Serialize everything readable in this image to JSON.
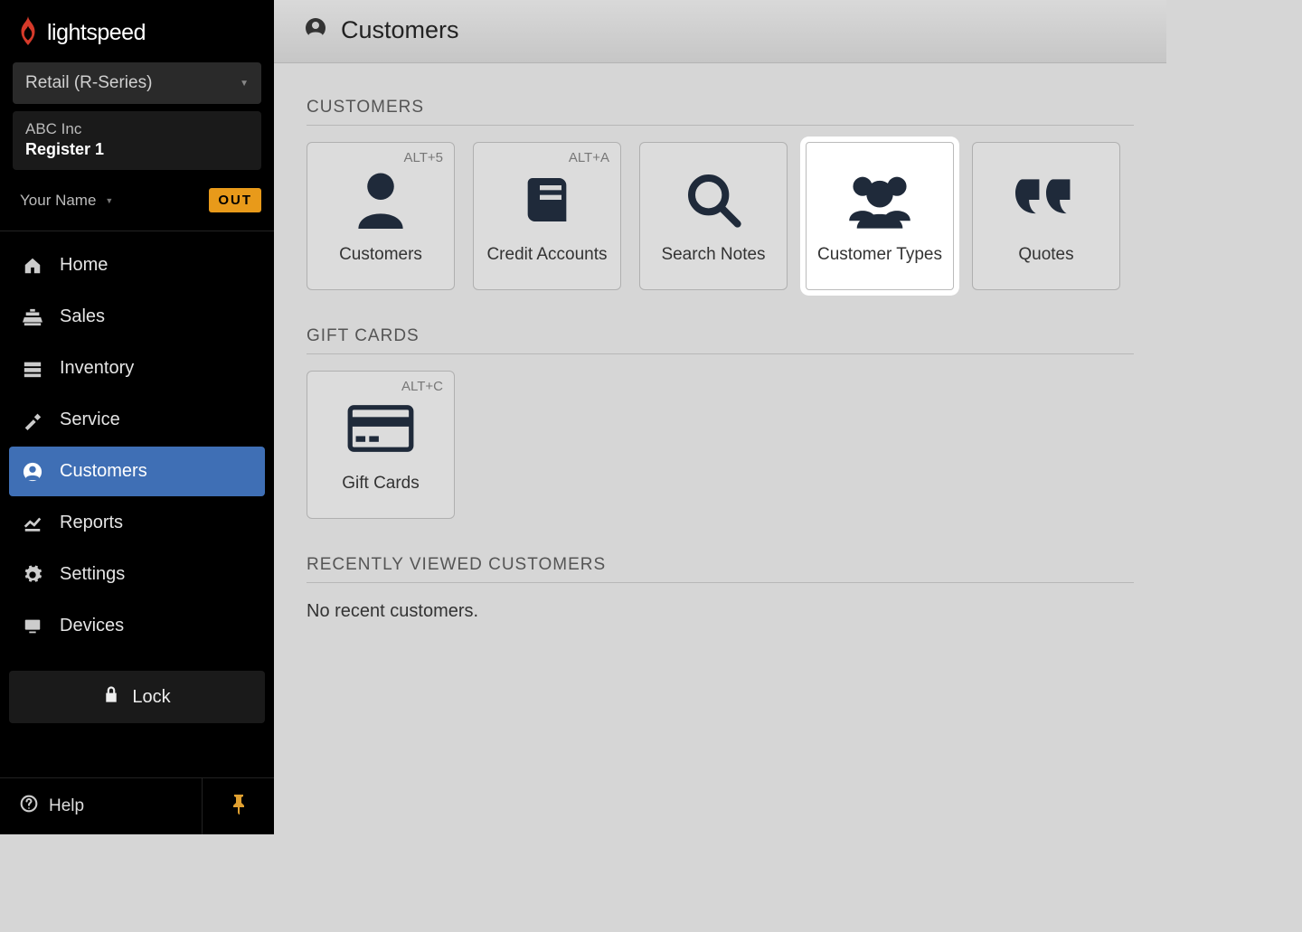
{
  "brand": "lightspeed",
  "product_selector": "Retail (R-Series)",
  "company": "ABC Inc",
  "register": "Register 1",
  "user_name": "Your Name",
  "out_label": "OUT",
  "nav": [
    {
      "label": "Home"
    },
    {
      "label": "Sales"
    },
    {
      "label": "Inventory"
    },
    {
      "label": "Service"
    },
    {
      "label": "Customers"
    },
    {
      "label": "Reports"
    },
    {
      "label": "Settings"
    },
    {
      "label": "Devices"
    }
  ],
  "lock_label": "Lock",
  "help_label": "Help",
  "page_title": "Customers",
  "sections": {
    "customers": {
      "heading": "CUSTOMERS",
      "tiles": [
        {
          "label": "Customers",
          "shortcut": "ALT+5"
        },
        {
          "label": "Credit Accounts",
          "shortcut": "ALT+A"
        },
        {
          "label": "Search Notes",
          "shortcut": ""
        },
        {
          "label": "Customer Types",
          "shortcut": ""
        },
        {
          "label": "Quotes",
          "shortcut": ""
        }
      ]
    },
    "giftcards": {
      "heading": "GIFT CARDS",
      "tiles": [
        {
          "label": "Gift Cards",
          "shortcut": "ALT+C"
        }
      ]
    },
    "recent": {
      "heading": "RECENTLY VIEWED CUSTOMERS",
      "empty_text": "No recent customers."
    }
  }
}
